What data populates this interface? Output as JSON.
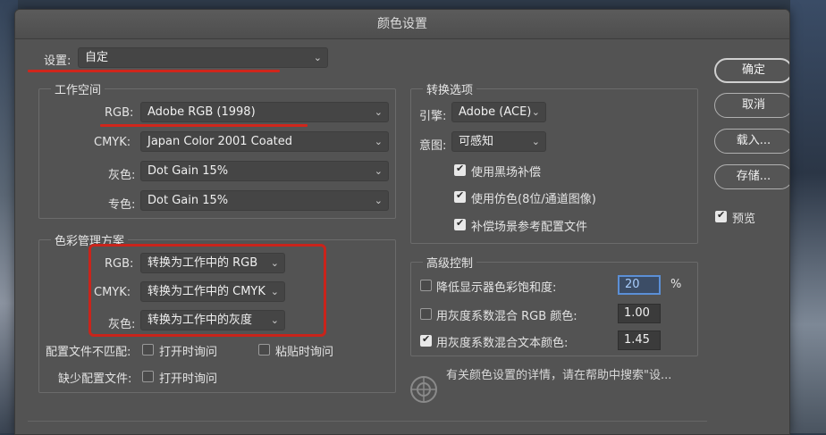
{
  "window": {
    "title": "颜色设置"
  },
  "settings": {
    "label": "设置:",
    "value": "自定"
  },
  "working_spaces": {
    "title": "工作空间",
    "rows": [
      {
        "label": "RGB:",
        "value": "Adobe RGB (1998)"
      },
      {
        "label": "CMYK:",
        "value": "Japan Color 2001 Coated"
      },
      {
        "label": "灰色:",
        "value": "Dot Gain 15%"
      },
      {
        "label": "专色:",
        "value": "Dot Gain 15%"
      }
    ]
  },
  "color_management": {
    "title": "色彩管理方案",
    "rows": [
      {
        "label": "RGB:",
        "value": "转换为工作中的 RGB"
      },
      {
        "label": "CMYK:",
        "value": "转换为工作中的 CMYK"
      },
      {
        "label": "灰色:",
        "value": "转换为工作中的灰度"
      }
    ],
    "mismatch_label": "配置文件不匹配:",
    "mismatch_open": {
      "label": "打开时询问",
      "checked": false
    },
    "mismatch_paste": {
      "label": "粘贴时询问",
      "checked": false
    },
    "missing_label": "缺少配置文件:",
    "missing_open": {
      "label": "打开时询问",
      "checked": false
    }
  },
  "conversion": {
    "title": "转换选项",
    "engine_label": "引擎:",
    "engine_value": "Adobe (ACE)",
    "intent_label": "意图:",
    "intent_value": "可感知",
    "options": [
      {
        "label": "使用黑场补偿",
        "checked": true
      },
      {
        "label": "使用仿色(8位/通道图像)",
        "checked": true
      },
      {
        "label": "补偿场景参考配置文件",
        "checked": true
      }
    ]
  },
  "advanced": {
    "title": "高级控制",
    "rows": [
      {
        "label": "降低显示器色彩饱和度:",
        "value": "20",
        "unit": "%",
        "checked": false
      },
      {
        "label": "用灰度系数混合 RGB 颜色:",
        "value": "1.00",
        "checked": false
      },
      {
        "label": "用灰度系数混合文本颜色:",
        "value": "1.45",
        "checked": true
      }
    ]
  },
  "info": {
    "text": "有关颜色设置的详情，请在帮助中搜索\"设..."
  },
  "buttons": {
    "ok": "确定",
    "cancel": "取消",
    "load": "载入...",
    "save": "存储..."
  },
  "preview": {
    "label": "预览",
    "checked": true
  },
  "colors": {
    "accent_red": "#c9241b",
    "dialog_bg": "#535353",
    "focus_blue": "#5b8fd6"
  },
  "icons": {
    "info": "color-wheel-icon",
    "chevron": "chevron-down-icon",
    "check": "checkmark-icon"
  }
}
